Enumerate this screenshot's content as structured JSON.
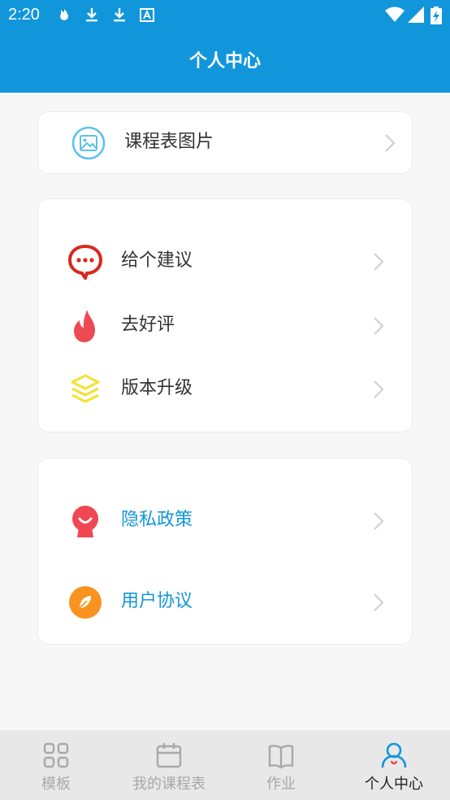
{
  "status_bar": {
    "time": "2:20",
    "left_icons": [
      "pinwheel-icon",
      "download-icon",
      "download-icon",
      "font-icon"
    ],
    "right_icons": [
      "wifi-icon",
      "signal-icon",
      "battery-charging-icon"
    ]
  },
  "header": {
    "title": "个人中心"
  },
  "sections": {
    "schedule": {
      "label": "课程表图片",
      "icon": "image-icon",
      "icon_color": "#59c1ec"
    },
    "feedback": {
      "items": [
        {
          "label": "给个建议",
          "icon": "chat-bubble-icon",
          "icon_color": "#d9271e"
        },
        {
          "label": "去好评",
          "icon": "flame-icon",
          "icon_color": "#ee4a54"
        },
        {
          "label": "版本升级",
          "icon": "layers-icon",
          "icon_color": "#f2e233"
        }
      ]
    },
    "legal": {
      "items": [
        {
          "label": "隐私政策",
          "icon": "smile-avatar-icon",
          "icon_color": "#f04753"
        },
        {
          "label": "用户协议",
          "icon": "compass-leaf-icon",
          "icon_color": "#f7931e"
        }
      ],
      "text_color": "#1296db"
    }
  },
  "tabs": [
    {
      "label": "模板",
      "icon": "grid-icon",
      "active": false
    },
    {
      "label": "我的课程表",
      "icon": "calendar-icon",
      "active": false
    },
    {
      "label": "作业",
      "icon": "book-icon",
      "active": false
    },
    {
      "label": "个人中心",
      "icon": "user-icon",
      "active": true
    }
  ],
  "colors": {
    "brand": "#1296db",
    "tab_inactive": "#a8a8a8",
    "tab_active": "#222222"
  }
}
